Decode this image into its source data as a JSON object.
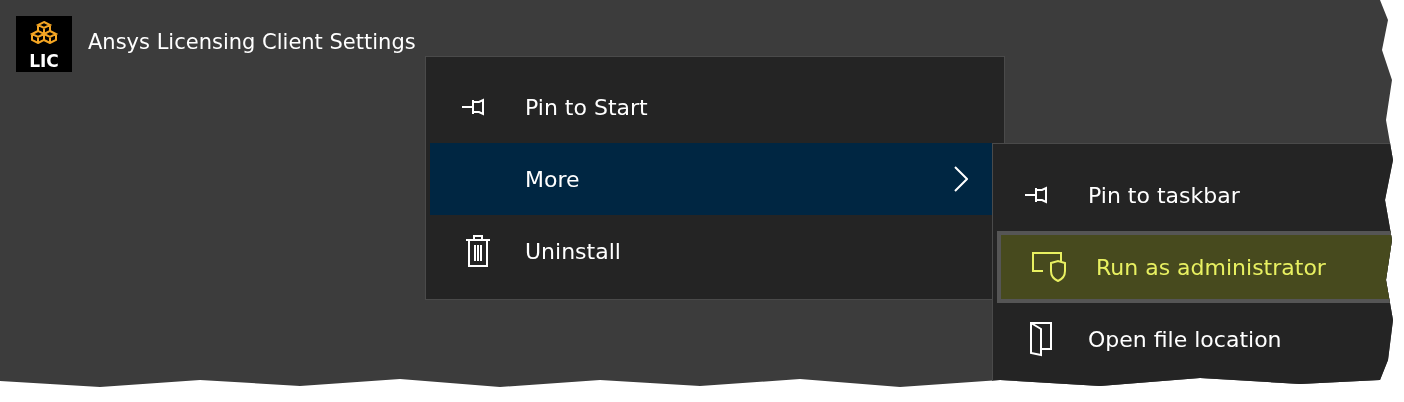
{
  "app": {
    "title": "Ansys Licensing Client Settings",
    "logo_text": "LIC"
  },
  "context_menu": {
    "items": [
      {
        "label": "Pin to Start",
        "kind": "pin",
        "selected": false,
        "submenu": false
      },
      {
        "label": "More",
        "kind": "none",
        "selected": true,
        "submenu": true
      },
      {
        "label": "Uninstall",
        "kind": "trash",
        "selected": false,
        "submenu": false
      }
    ]
  },
  "submenu": {
    "items": [
      {
        "label": "Pin to taskbar",
        "kind": "pin",
        "selected": false
      },
      {
        "label": "Run as administrator",
        "kind": "shield",
        "selected": true
      },
      {
        "label": "Open file location",
        "kind": "folder",
        "selected": false
      }
    ]
  }
}
